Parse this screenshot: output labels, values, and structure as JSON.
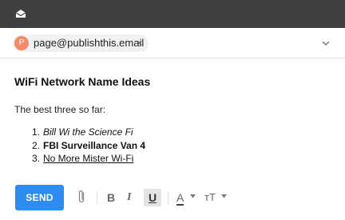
{
  "icons": {
    "app": "envelope-icon",
    "chip_remove": "close-icon",
    "expand": "chevron-down-icon",
    "attach": "paperclip-icon"
  },
  "recipient": {
    "initial": "P",
    "email": "page@publishthis.email",
    "remove_symbol": "×",
    "avatar_color": "#f28b68"
  },
  "message": {
    "subject": "WiFi Network Name Ideas",
    "intro": "The best three so far:",
    "items": [
      {
        "number": "1.",
        "text": "Bill Wi the Science Fi",
        "style": "italic"
      },
      {
        "number": "2.",
        "text": "FBI Surveillance Van 4",
        "style": "bold"
      },
      {
        "number": "3.",
        "text": "No More Mister Wi-Fi",
        "style": "underline"
      }
    ]
  },
  "toolbar": {
    "send_label": "SEND",
    "bold_label": "B",
    "italic_label": "I",
    "underline_label": "U",
    "underline_active": true,
    "text_color_label": "A",
    "text_size_label": "тT"
  },
  "colors": {
    "titlebar": "#404040",
    "send_button": "#2d8cf0",
    "active_tool_bg": "#e3e3e3"
  }
}
